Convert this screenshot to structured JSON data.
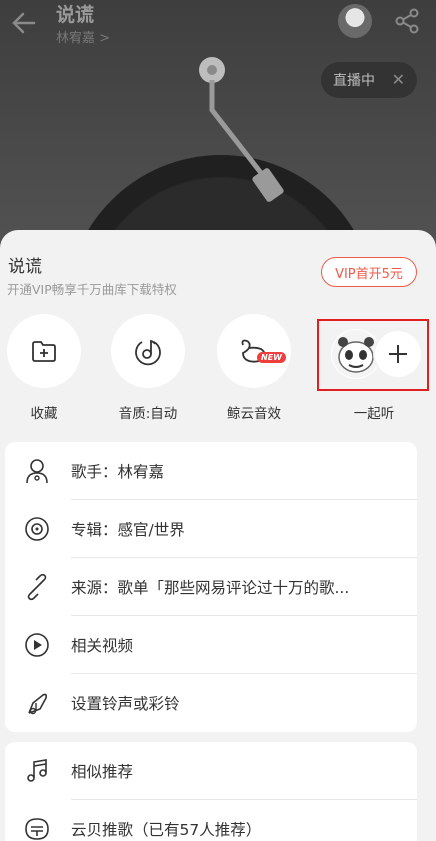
{
  "header": {
    "title": "说谎",
    "artist": "林宥嘉 >",
    "live_label": "直播中",
    "live_close": "✕"
  },
  "sheet": {
    "title": "说谎",
    "subtitle": "开通VIP畅享千万曲库下载特权",
    "vip_button": "VIP首开5元"
  },
  "actions": {
    "collect": "收藏",
    "quality": "音质:自动",
    "whale_effect": "鲸云音效",
    "whale_badge": "NEW",
    "listen_together": "一起听"
  },
  "menu_main": [
    {
      "label": "歌手：林宥嘉",
      "icon": "singer-icon"
    },
    {
      "label": "专辑：感官/世界",
      "icon": "album-icon"
    },
    {
      "label": "来源：歌单「那些网易评论过十万的歌...",
      "icon": "link-icon"
    },
    {
      "label": "相关视频",
      "icon": "video-icon"
    },
    {
      "label": "设置铃声或彩铃",
      "icon": "ringtone-icon"
    }
  ],
  "menu_more": [
    {
      "label": "相似推荐",
      "icon": "similar-music-icon"
    },
    {
      "label": "云贝推歌（已有57人推荐）",
      "icon": "yunbei-icon"
    }
  ],
  "colors": {
    "accent": "#f05a4a",
    "highlight_box": "#e02020",
    "sheet_bg": "#f2f2f2"
  }
}
